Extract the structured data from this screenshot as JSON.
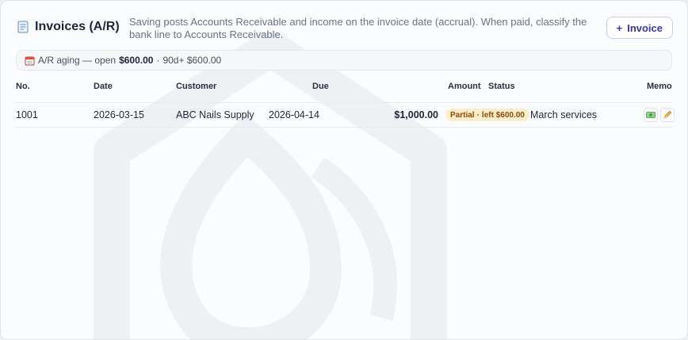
{
  "header": {
    "icon": "receipt-icon",
    "title": "Invoices (A/R)",
    "description": "Saving posts Accounts Receivable and income on the invoice date (accrual). When paid, classify the bank line to Accounts Receivable.",
    "add_button": {
      "plus": "+",
      "label": "Invoice"
    }
  },
  "aging": {
    "icon": "calendar-icon",
    "prefix": "A/R aging — open",
    "open_amount": "$600.00",
    "sep": "·",
    "bucket_text": "90d+ $600.00"
  },
  "table": {
    "columns": {
      "no": "No.",
      "date": "Date",
      "customer": "Customer",
      "due": "Due",
      "amount": "Amount",
      "status": "Status",
      "memo": "Memo"
    },
    "rows": [
      {
        "no": "1001",
        "date": "2026-03-15",
        "customer": "ABC Nails Supply",
        "due": "2026-04-14",
        "amount": "$1,000.00",
        "status_part": "Partial",
        "status_sep": "·",
        "status_left": "left $600.00",
        "memo": "March services",
        "actions": [
          "money-icon",
          "pencil-icon"
        ]
      }
    ]
  },
  "colors": {
    "accent": "#3a36a8",
    "badge_bg": "#fdeecb",
    "badge_text": "#8a4a06",
    "title": "#1e2536"
  }
}
